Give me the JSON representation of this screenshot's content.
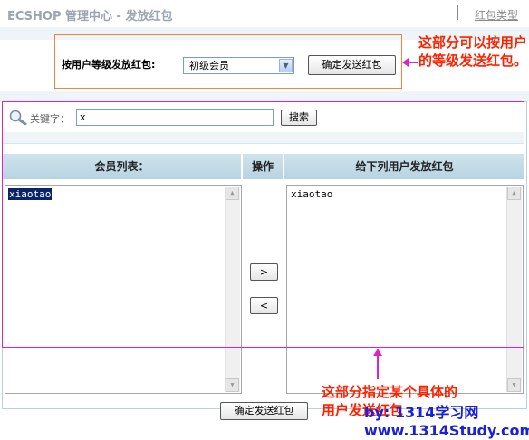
{
  "header": {
    "title": "ECSHOP 管理中心 - 发放红包",
    "link_bonus_type": "红包类型"
  },
  "rank_form": {
    "label": "按用户等级发放红包:",
    "selected_rank": "初级会员",
    "send_button": "确定发送红包"
  },
  "search": {
    "label": "关键字：",
    "value": "x",
    "button": "搜索"
  },
  "table": {
    "col_members": "会员列表：",
    "col_ops": "操作",
    "col_targets": "给下列用户发放红包"
  },
  "member_list": [
    "xiaotao"
  ],
  "target_list": [
    "xiaotao"
  ],
  "ops": {
    "add": ">",
    "remove": "<"
  },
  "bottom_send_button": "确定发送红包",
  "annotations": {
    "callout_top": "这部分可以按用户的等级发送红包。",
    "callout_bottom": "这部分指定某个具体的用户发送红包",
    "color": "#ff2100",
    "box_top_color": "#f2853d",
    "box_bottom_color": "#e020c8"
  },
  "watermark": {
    "line1": "by: 1314学习网",
    "line2": "www.1314Study.com"
  }
}
